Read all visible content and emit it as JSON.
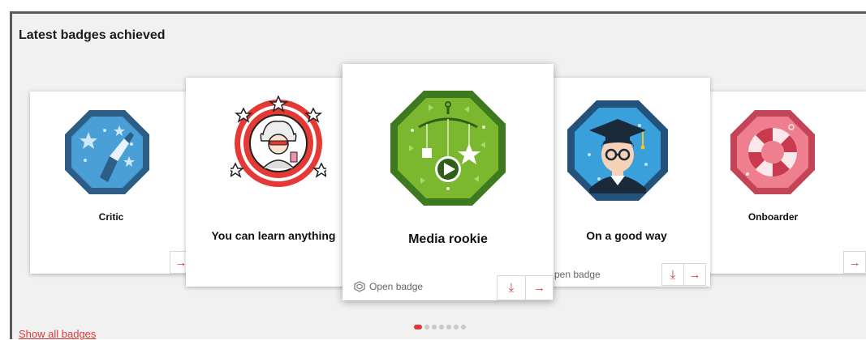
{
  "section_title": "Latest badges achieved",
  "show_all_link": "Show all badges",
  "open_badge_label": "Open badge",
  "open_badge_partial": "pen badge",
  "badges": [
    {
      "name": "Critic"
    },
    {
      "name": "You can learn anything"
    },
    {
      "name": "Media rookie"
    },
    {
      "name": "On a good way"
    },
    {
      "name": "Onboarder"
    }
  ],
  "arrow_glyph": "→",
  "download_glyph": "⤓",
  "carousel_dots": 7,
  "active_dot": 0,
  "colors": {
    "accent": "#e03838",
    "critic_fill": "#4a9fd6",
    "critic_border": "#2c5e86",
    "learn_ring": "#e53935",
    "media_fill": "#7cb82f",
    "media_border": "#3d7a1f",
    "goodway_fill": "#3aa0dc",
    "goodway_border": "#23527a",
    "onboarder_fill": "#ef7f8f",
    "onboarder_border": "#c24456"
  }
}
